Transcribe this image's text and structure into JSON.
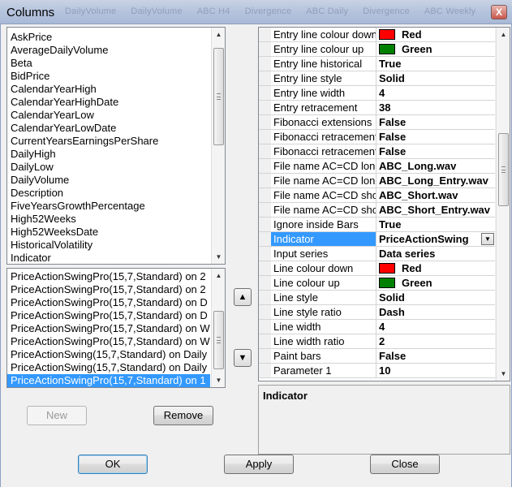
{
  "window": {
    "title": "Columns",
    "background_tabs": [
      "DailyVolume",
      "DailyVolume",
      "ABC H4",
      "Divergence",
      "ABC Daily",
      "Divergence",
      "ABC Weekly",
      "Divergence"
    ],
    "close_glyph": "X"
  },
  "available_columns": {
    "items": [
      "AskPrice",
      "AverageDailyVolume",
      "Beta",
      "BidPrice",
      "CalendarYearHigh",
      "CalendarYearHighDate",
      "CalendarYearLow",
      "CalendarYearLowDate",
      "CurrentYearsEarningsPerShare",
      "DailyHigh",
      "DailyLow",
      "DailyVolume",
      "Description",
      "FiveYearsGrowthPercentage",
      "High52Weeks",
      "High52WeeksDate",
      "HistoricalVolatility",
      "Indicator"
    ],
    "scroll_up_icon": "scroll-up-arrow",
    "scroll_down_icon": "scroll-down-arrow"
  },
  "selected_columns": {
    "items": [
      "PriceActionSwingPro(15,7,Standard) on 2",
      "PriceActionSwingPro(15,7,Standard) on 2",
      "PriceActionSwingPro(15,7,Standard) on D",
      "PriceActionSwingPro(15,7,Standard) on D",
      "PriceActionSwingPro(15,7,Standard) on W",
      "PriceActionSwingPro(15,7,Standard) on W",
      "PriceActionSwing(15,7,Standard) on Daily",
      "PriceActionSwing(15,7,Standard) on Daily",
      "PriceActionSwingPro(15,7,Standard) on 1"
    ],
    "selected_index": 8
  },
  "move_buttons": {
    "up_glyph": "▲",
    "down_glyph": "▼"
  },
  "properties": {
    "rows": [
      {
        "name": "Entry line colour down",
        "value": "Red",
        "swatch": "#ff0000"
      },
      {
        "name": "Entry line colour up",
        "value": "Green",
        "swatch": "#008000"
      },
      {
        "name": "Entry line historical",
        "value": "True"
      },
      {
        "name": "Entry line style",
        "value": "Solid"
      },
      {
        "name": "Entry line width",
        "value": "4"
      },
      {
        "name": "Entry retracement",
        "value": "38"
      },
      {
        "name": "Fibonacci extensions",
        "value": "False"
      },
      {
        "name": "Fibonacci retracement",
        "value": "False"
      },
      {
        "name": "Fibonacci retracement",
        "value": "False"
      },
      {
        "name": "File name AC=CD long",
        "value": "ABC_Long.wav"
      },
      {
        "name": "File name AC=CD long",
        "value": "ABC_Long_Entry.wav"
      },
      {
        "name": "File name AC=CD short",
        "value": "ABC_Short.wav"
      },
      {
        "name": "File name AC=CD short",
        "value": "ABC_Short_Entry.wav"
      },
      {
        "name": "Ignore inside Bars",
        "value": "True"
      },
      {
        "name": "Indicator",
        "value": "PriceActionSwing",
        "selected": true,
        "dropdown": true
      },
      {
        "name": "Input series",
        "value": "Data series"
      },
      {
        "name": "Line colour down",
        "value": "Red",
        "swatch": "#ff0000"
      },
      {
        "name": "Line colour up",
        "value": "Green",
        "swatch": "#008000"
      },
      {
        "name": "Line style",
        "value": "Solid"
      },
      {
        "name": "Line style ratio",
        "value": "Dash"
      },
      {
        "name": "Line width",
        "value": "4"
      },
      {
        "name": "Line width ratio",
        "value": "2"
      },
      {
        "name": "Paint bars",
        "value": "False"
      },
      {
        "name": "Parameter 1",
        "value": "10"
      }
    ]
  },
  "description": {
    "title": "Indicator"
  },
  "buttons": {
    "new_label": "New",
    "remove_label": "Remove",
    "ok_label": "OK",
    "apply_label": "Apply",
    "close_label": "Close"
  },
  "colors": {
    "selection": "#3399ff",
    "red_swatch": "#ff0000",
    "green_swatch": "#008000"
  }
}
